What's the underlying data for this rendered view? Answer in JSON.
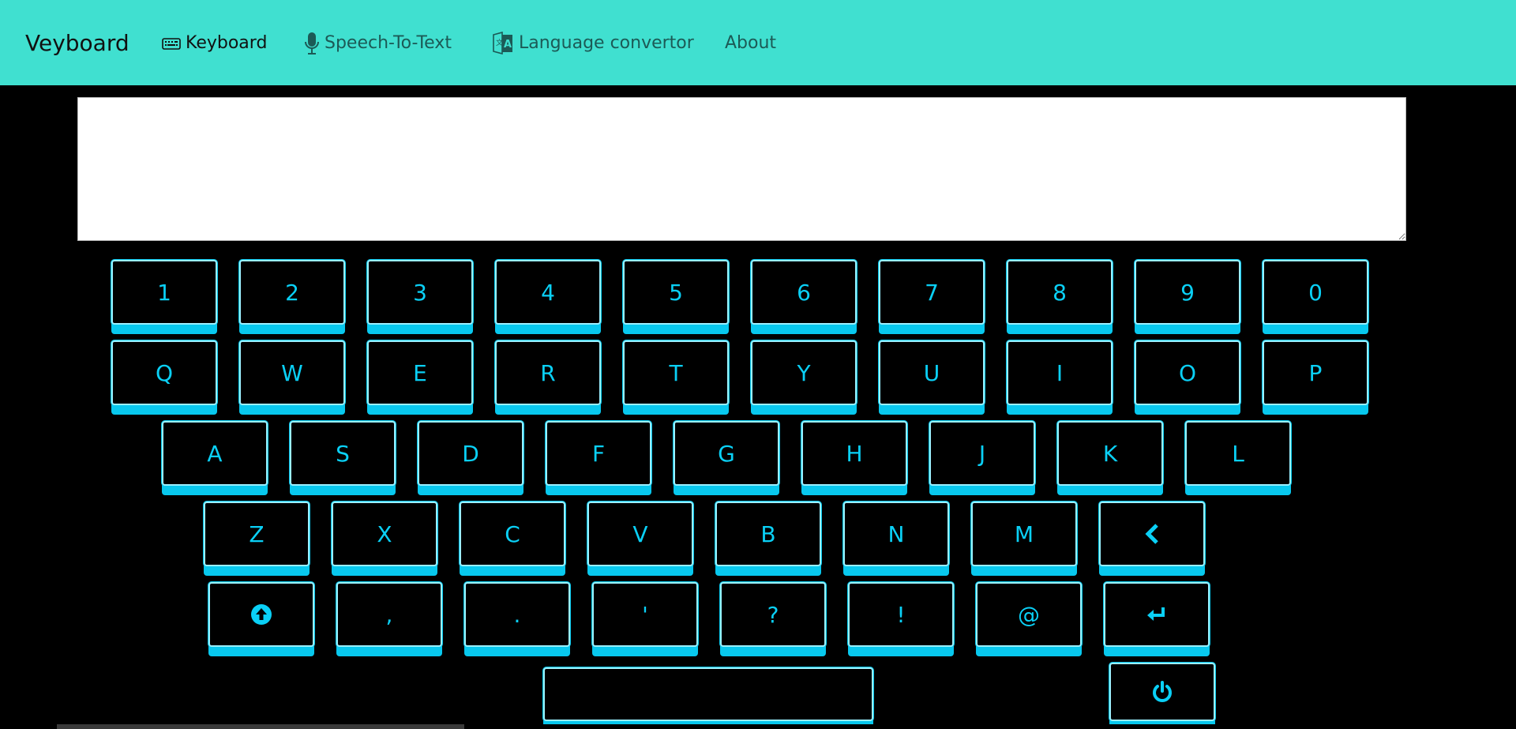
{
  "nav": {
    "brand": "Veyboard",
    "links": [
      {
        "label": "Keyboard",
        "icon": "keyboard-icon",
        "active": true
      },
      {
        "label": "Speech-To-Text",
        "icon": "microphone-icon",
        "active": false
      },
      {
        "label": "Language convertor",
        "icon": "translate-icon",
        "active": false
      },
      {
        "label": "About",
        "icon": "",
        "active": false
      }
    ]
  },
  "editor": {
    "value": ""
  },
  "keyboard": {
    "rows": [
      [
        "1",
        "2",
        "3",
        "4",
        "5",
        "6",
        "7",
        "8",
        "9",
        "0"
      ],
      [
        "Q",
        "W",
        "E",
        "R",
        "T",
        "Y",
        "U",
        "I",
        "O",
        "P"
      ],
      [
        "A",
        "S",
        "D",
        "F",
        "G",
        "H",
        "J",
        "K",
        "L"
      ],
      [
        "Z",
        "X",
        "C",
        "V",
        "B",
        "N",
        "M"
      ],
      [
        ",",
        ".",
        "'",
        "?",
        "!",
        "@"
      ]
    ],
    "special_keys": {
      "backspace": "chevron-left-icon",
      "shift": "arrow-up-circle-icon",
      "enter": "enter-arrow-icon",
      "space": "",
      "power": "power-icon"
    },
    "colors": {
      "accent": "#08c8ee",
      "text": "#0ad0f6",
      "border": "#9aefff",
      "nav": "#40e0d0"
    }
  }
}
